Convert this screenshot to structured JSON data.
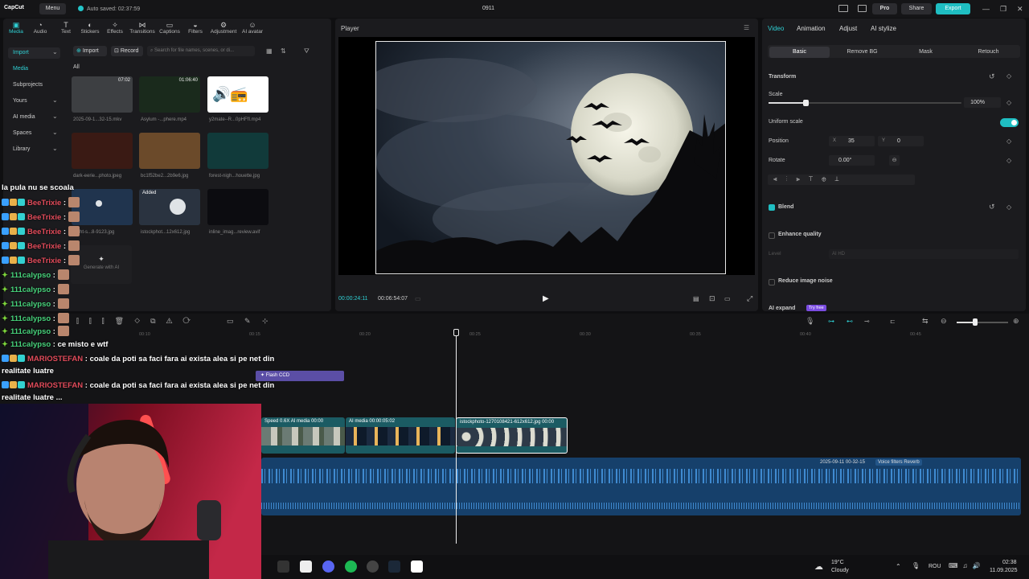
{
  "app": {
    "name": "CapCut",
    "menu_label": "Menu",
    "autosave": "Auto saved: 02:37:59",
    "project_title": "0911",
    "pro_label": "Pro",
    "share_label": "Share",
    "export_label": "Export"
  },
  "toolbar": {
    "tools": [
      "Media",
      "Audio",
      "Text",
      "Stickers",
      "Effects",
      "Transitions",
      "Captions",
      "Filters",
      "Adjustment",
      "AI avatar"
    ]
  },
  "left_nav": {
    "items": [
      "Import",
      "Media",
      "Subprojects",
      "Yours",
      "AI media",
      "Spaces",
      "Library"
    ]
  },
  "media": {
    "import_label": "Import",
    "record_label": "Record",
    "search_placeholder": "Search for file names, scenes, or di...",
    "all_label": "All",
    "items": [
      {
        "name": "2025-09-1...32-15.mkv",
        "duration": "07:02"
      },
      {
        "name": "Asylum -...phere.mp4",
        "duration": "01:06:40"
      },
      {
        "name": "y2mate--R...0pHFfI.mp4",
        "duration": ""
      },
      {
        "name": "dark-eerie...photo.jpeg",
        "duration": ""
      },
      {
        "name": "bc1f52be2...2b9e6.jpg",
        "duration": ""
      },
      {
        "name": "forest-nigh...houette.jpg",
        "duration": ""
      },
      {
        "name": "night-s...8-9123.jpg",
        "duration": ""
      },
      {
        "name": "istockphot...12x612.jpg",
        "duration": "",
        "badge": "Added"
      },
      {
        "name": "inline_imag...review.avif",
        "duration": ""
      }
    ],
    "generate_label": "Generate with AI"
  },
  "chat": {
    "lines": [
      {
        "user": "",
        "text": "la pula nu se scoala"
      },
      {
        "user": "BeeTrixie",
        "text": ":"
      },
      {
        "user": "BeeTrixie",
        "text": ":"
      },
      {
        "user": "BeeTrixie",
        "text": ":"
      },
      {
        "user": "BeeTrixie",
        "text": ":"
      },
      {
        "user": "BeeTrixie",
        "text": ":"
      },
      {
        "user": "111calypso",
        "text": ":"
      },
      {
        "user": "111calypso",
        "text": ":"
      },
      {
        "user": "111calypso",
        "text": ":"
      },
      {
        "user": "111calypso",
        "text": ":"
      },
      {
        "user": "111calypso",
        "text": ":"
      },
      {
        "user": "111calypso",
        "text": ": ce misto e wtf"
      },
      {
        "user": "MARIOSTEFAN",
        "text": ": coale da poti sa faci fara ai exista alea si pe net din"
      },
      {
        "user": "",
        "text": "realitate luatre"
      },
      {
        "user": "MARIOSTEFAN",
        "text": ": coale da poti sa faci fara ai exista alea si pe net din"
      },
      {
        "user": "",
        "text": "realitate luatre ..."
      }
    ]
  },
  "player": {
    "title": "Player",
    "current_time": "00:00:24:11",
    "total_time": "00:06:54:07"
  },
  "inspector": {
    "tabs": [
      "Video",
      "Animation",
      "Adjust",
      "AI stylize"
    ],
    "subtabs": [
      "Basic",
      "Remove BG",
      "Mask",
      "Retouch"
    ],
    "transform_label": "Transform",
    "scale_label": "Scale",
    "scale_value": "100%",
    "scale_fraction": 0.19,
    "uniform_scale_label": "Uniform scale",
    "position_label": "Position",
    "pos_x_label": "X",
    "pos_x": "35",
    "pos_y_label": "Y",
    "pos_y": "0",
    "rotate_label": "Rotate",
    "rotate_value": "0.00°",
    "blend_label": "Blend",
    "enhance_label": "Enhance quality",
    "level_label": "Level",
    "level_value": "AI HD",
    "noise_label": "Reduce image noise",
    "expand_label": "AI expand",
    "expand_badge": "Try free"
  },
  "timeline": {
    "ruler": [
      "00:10",
      "00:15",
      "00:20",
      "00:25",
      "00:30",
      "00:35",
      "00:40",
      "00:45"
    ],
    "effect_clip": "Flash CCD",
    "clips": [
      {
        "label": "Speed 0.6X",
        "label2": "AI media",
        "label3": "00:00"
      },
      {
        "label": "AI media",
        "label2": "00:00:05:02"
      },
      {
        "label": "istockphoto-1270108421-612x612.jpg",
        "label2": "00:00"
      }
    ],
    "audio_label": "2025-09-11 00-32-15",
    "audio_filter": "Voice filters Reverb"
  },
  "taskbar": {
    "weather_temp": "19°C",
    "weather_desc": "Cloudy",
    "lang": "ROU",
    "time": "02:38",
    "date": "11.09.2025"
  },
  "colors": {
    "accent": "#1fbec2",
    "bg": "#0f0f11",
    "panel": "#1b1b1e",
    "clip_teal": "#1b5b63",
    "audio": "#1a4f86"
  }
}
